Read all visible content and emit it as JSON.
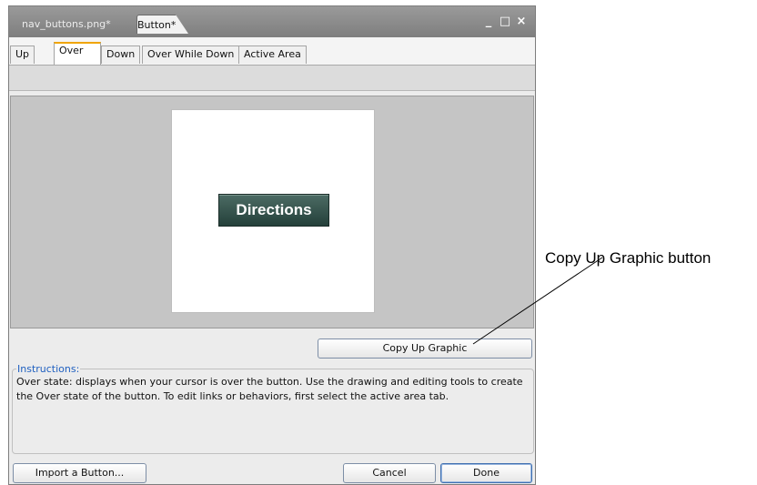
{
  "window": {
    "doc_tabs": [
      "nav_buttons.png*",
      "Button*"
    ],
    "controls": {
      "minimize": "_",
      "restore": "□",
      "close": "×"
    }
  },
  "state_tabs": [
    "Up",
    "Over",
    "Down",
    "Over While Down",
    "Active Area"
  ],
  "selected_state_tab": "Over",
  "canvas": {
    "preview_button_label": "Directions"
  },
  "copy_up_graphic_label": "Copy Up Graphic",
  "instructions": {
    "legend": "Instructions:",
    "text": "Over state: displays when your cursor is over the button. Use the drawing and editing tools to create the Over state of the button. To edit links or behaviors, first select the active area tab."
  },
  "footer": {
    "import_label": "Import a Button...",
    "cancel_label": "Cancel",
    "done_label": "Done"
  },
  "annotation": {
    "callout_text": "Copy Up Graphic button"
  },
  "colors": {
    "accent_tab": "#f0a400",
    "legend_text": "#2060c0",
    "preview_button": "#2f4d47"
  }
}
